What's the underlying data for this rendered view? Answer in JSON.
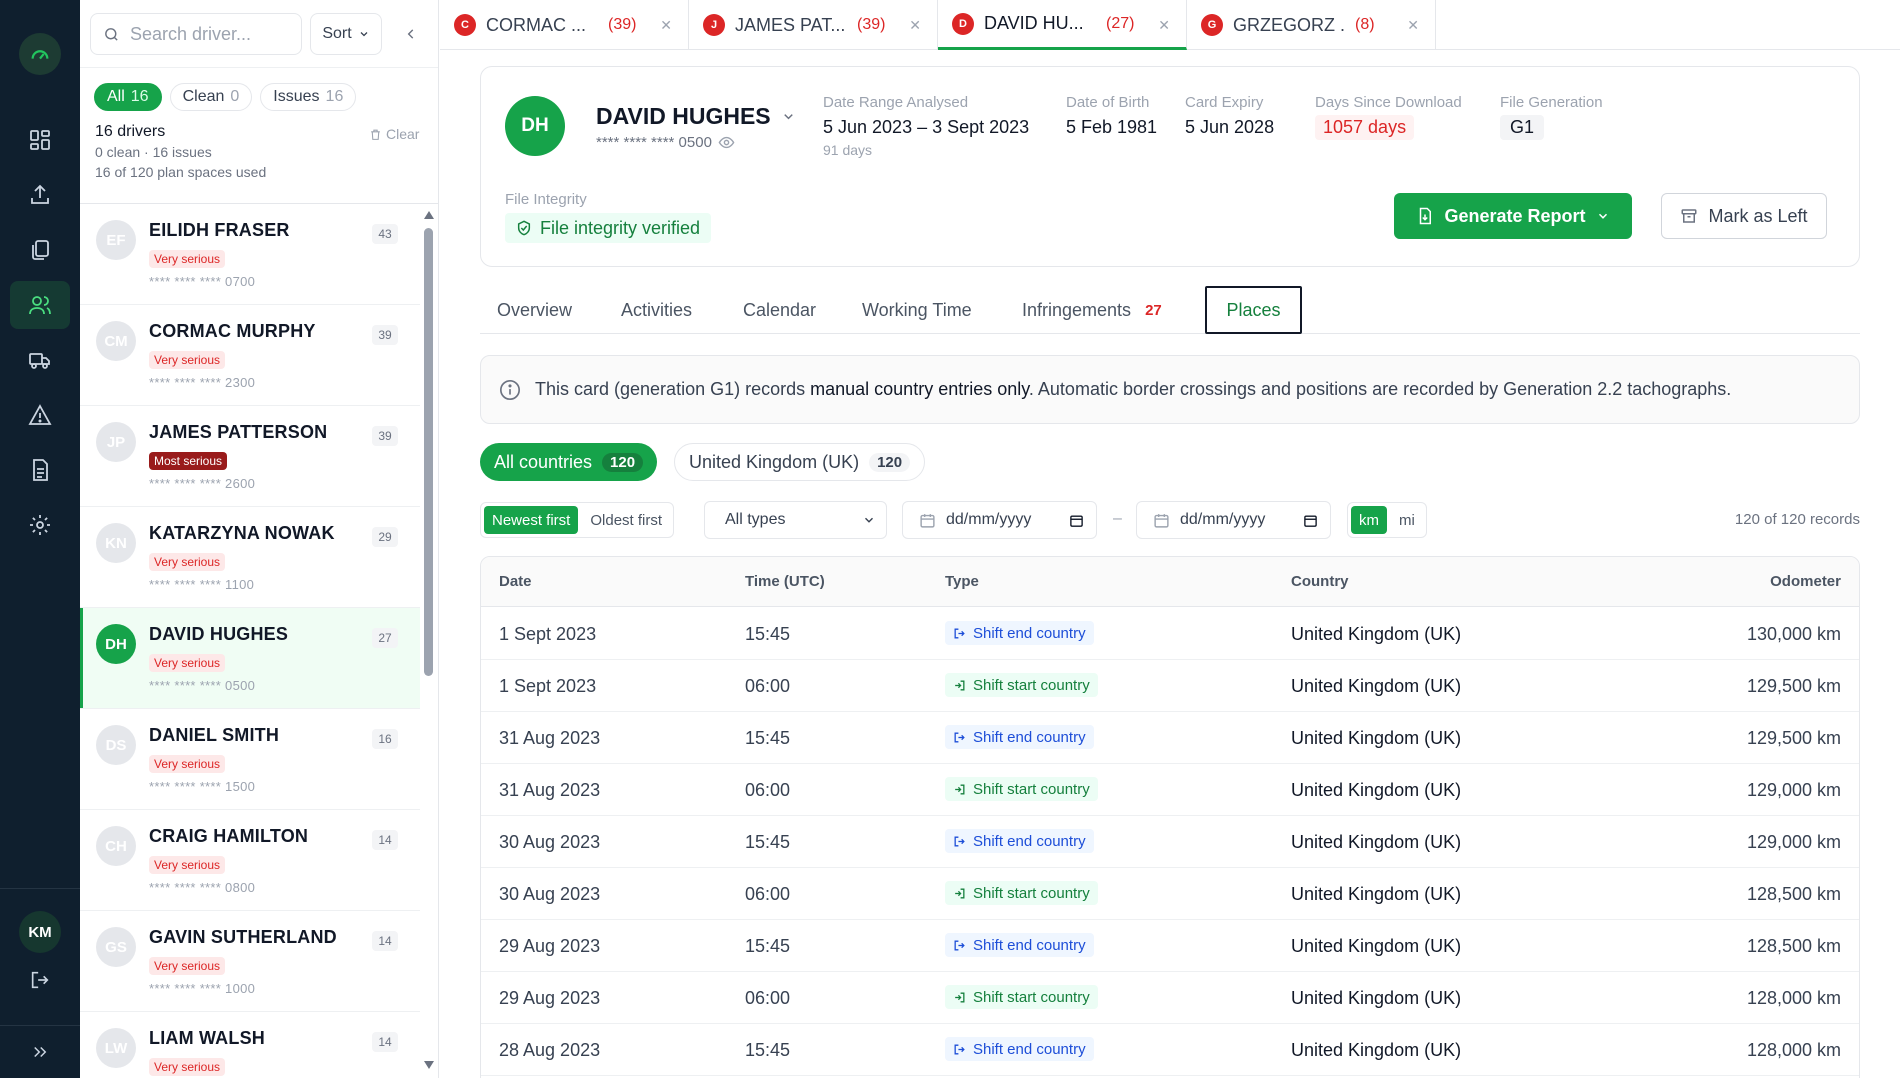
{
  "rail": {
    "avatar_initials": "KM",
    "icons": [
      "dashboard-icon",
      "upload-icon",
      "files-icon",
      "drivers-icon",
      "vehicles-icon",
      "alert-icon",
      "report-icon",
      "settings-icon"
    ]
  },
  "driver_panel": {
    "search_placeholder": "Search driver...",
    "sort_label": "Sort",
    "filters": [
      {
        "label": "All",
        "count": "16"
      },
      {
        "label": "Clean",
        "count": "0"
      },
      {
        "label": "Issues",
        "count": "16"
      }
    ],
    "summary": {
      "line1": "16 drivers",
      "line2": "0 clean · 16 issues",
      "line3": "16 of 120 plan spaces used"
    },
    "clear_label": "Clear",
    "drivers": [
      {
        "initials": "EF",
        "name": "EILIDH FRASER",
        "severity": "Very serious",
        "card": "**** **** **** 0700",
        "count": "43"
      },
      {
        "initials": "CM",
        "name": "CORMAC MURPHY",
        "severity": "Very serious",
        "card": "**** **** **** 2300",
        "count": "39"
      },
      {
        "initials": "JP",
        "name": "JAMES PATTERSON",
        "severity": "Most serious",
        "card": "**** **** **** 2600",
        "count": "39"
      },
      {
        "initials": "KN",
        "name": "KATARZYNA NOWAK",
        "severity": "Very serious",
        "card": "**** **** **** 1100",
        "count": "29"
      },
      {
        "initials": "DH",
        "name": "DAVID HUGHES",
        "severity": "Very serious",
        "card": "**** **** **** 0500",
        "count": "27"
      },
      {
        "initials": "DS",
        "name": "DANIEL SMITH",
        "severity": "Very serious",
        "card": "**** **** **** 1500",
        "count": "16"
      },
      {
        "initials": "CH",
        "name": "CRAIG HAMILTON",
        "severity": "Very serious",
        "card": "**** **** **** 0800",
        "count": "14"
      },
      {
        "initials": "GS",
        "name": "GAVIN SUTHERLAND",
        "severity": "Very serious",
        "card": "**** **** **** 1000",
        "count": "14"
      },
      {
        "initials": "LW",
        "name": "LIAM WALSH",
        "severity": "Very serious",
        "card": "",
        "count": "14"
      }
    ]
  },
  "open_tabs": [
    {
      "initial": "C",
      "name": "CORMAC ...",
      "count": "(39)"
    },
    {
      "initial": "J",
      "name": "JAMES PAT...",
      "count": "(39)"
    },
    {
      "initial": "D",
      "name": "DAVID HU...",
      "count": "(27)"
    },
    {
      "initial": "G",
      "name": "GRZEGORZ ...",
      "count": "(8)"
    }
  ],
  "header": {
    "initials": "DH",
    "name": "DAVID HUGHES",
    "card": "**** **** **** 0500",
    "date_range": {
      "label": "Date Range Analysed",
      "value": "5 Jun 2023 – 3 Sept 2023",
      "sub": "91 days"
    },
    "dob": {
      "label": "Date of Birth",
      "value": "5 Feb 1981"
    },
    "expiry": {
      "label": "Card Expiry",
      "value": "5 Jun 2028"
    },
    "days_since": {
      "label": "Days Since Download",
      "value": "1057 days"
    },
    "generation": {
      "label": "File Generation",
      "value": "G1"
    },
    "integrity_label": "File Integrity",
    "integrity_value": "File integrity verified",
    "generate_label": "Generate Report",
    "mark_left_label": "Mark as Left"
  },
  "section_tabs": [
    {
      "label": "Overview"
    },
    {
      "label": "Activities"
    },
    {
      "label": "Calendar"
    },
    {
      "label": "Working Time"
    },
    {
      "label": "Infringements",
      "badge": "27"
    },
    {
      "label": "Places"
    }
  ],
  "info": {
    "pre": "This card (generation G1) records ",
    "bold": "manual country entries only",
    "post": ". Automatic border crossings and positions are recorded by Generation 2.2 tachographs."
  },
  "country_filters": [
    {
      "label": "All countries",
      "count": "120"
    },
    {
      "label": "United Kingdom (UK)",
      "count": "120"
    }
  ],
  "controls": {
    "order": [
      "Newest first",
      "Oldest first"
    ],
    "type_select": "All types",
    "date_placeholder": "dd/mm/yyyy",
    "units": [
      "km",
      "mi"
    ],
    "record_count": "120 of 120 records"
  },
  "table": {
    "headers": [
      "Date",
      "Time (UTC)",
      "Type",
      "Country",
      "Odometer"
    ],
    "rows": [
      {
        "date": "1 Sept 2023",
        "time": "15:45",
        "type": "Shift end country",
        "kind": "end",
        "country": "United Kingdom (UK)",
        "odo": "130,000 km"
      },
      {
        "date": "1 Sept 2023",
        "time": "06:00",
        "type": "Shift start country",
        "kind": "start",
        "country": "United Kingdom (UK)",
        "odo": "129,500 km"
      },
      {
        "date": "31 Aug 2023",
        "time": "15:45",
        "type": "Shift end country",
        "kind": "end",
        "country": "United Kingdom (UK)",
        "odo": "129,500 km"
      },
      {
        "date": "31 Aug 2023",
        "time": "06:00",
        "type": "Shift start country",
        "kind": "start",
        "country": "United Kingdom (UK)",
        "odo": "129,000 km"
      },
      {
        "date": "30 Aug 2023",
        "time": "15:45",
        "type": "Shift end country",
        "kind": "end",
        "country": "United Kingdom (UK)",
        "odo": "129,000 km"
      },
      {
        "date": "30 Aug 2023",
        "time": "06:00",
        "type": "Shift start country",
        "kind": "start",
        "country": "United Kingdom (UK)",
        "odo": "128,500 km"
      },
      {
        "date": "29 Aug 2023",
        "time": "15:45",
        "type": "Shift end country",
        "kind": "end",
        "country": "United Kingdom (UK)",
        "odo": "128,500 km"
      },
      {
        "date": "29 Aug 2023",
        "time": "06:00",
        "type": "Shift start country",
        "kind": "start",
        "country": "United Kingdom (UK)",
        "odo": "128,000 km"
      },
      {
        "date": "28 Aug 2023",
        "time": "15:45",
        "type": "Shift end country",
        "kind": "end",
        "country": "United Kingdom (UK)",
        "odo": "128,000 km"
      }
    ]
  },
  "colors": {
    "accent": "#16a34a",
    "sidebar": "#0f1f2e",
    "danger": "#dc2626"
  }
}
